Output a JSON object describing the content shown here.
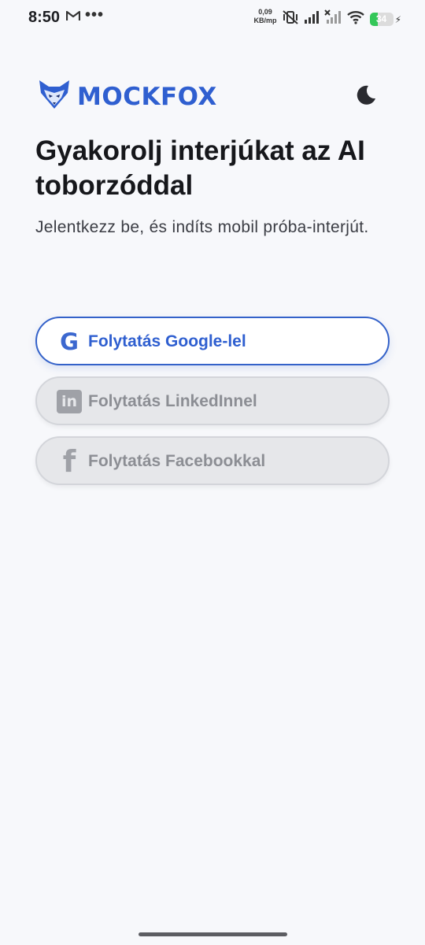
{
  "status_bar": {
    "time": "8:50",
    "more": "•••",
    "speed_value": "0,09",
    "speed_unit": "KB/mp",
    "battery": "34"
  },
  "header": {
    "brand": "MOCKFOX",
    "brand_color": "#2f5fd0",
    "theme_icon": "moon-icon"
  },
  "main": {
    "title": "Gyakorolj interjúkat az AI toborzóddal",
    "subtitle": "Jelentkezz be, és indíts mobil próba-interjút."
  },
  "auth_buttons": [
    {
      "label": "Folytatás Google-lel",
      "icon": "google-icon",
      "icon_glyph": "G",
      "state": "active"
    },
    {
      "label": "Folytatás LinkedInnel",
      "icon": "linkedin-icon",
      "icon_glyph": "in",
      "state": "disabled"
    },
    {
      "label": "Folytatás Facebookkal",
      "icon": "facebook-icon",
      "icon_glyph": "f",
      "state": "disabled"
    }
  ]
}
